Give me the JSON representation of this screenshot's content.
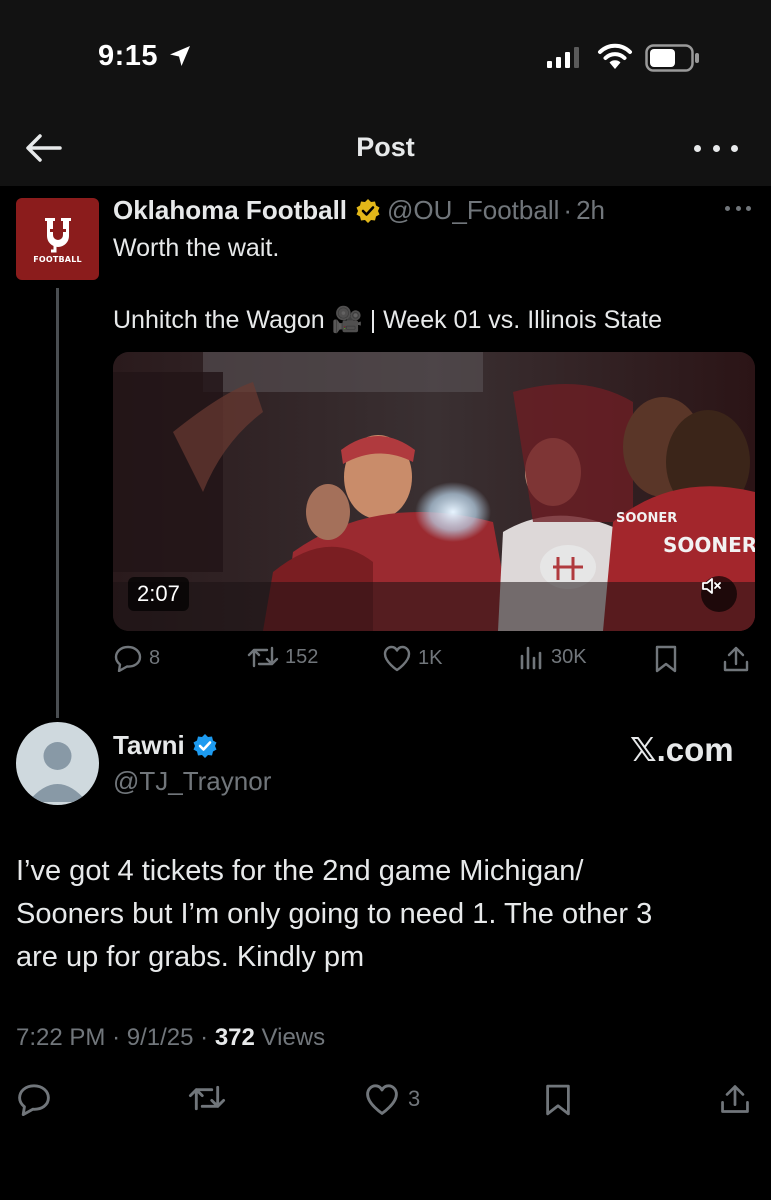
{
  "status_bar": {
    "time": "9:15"
  },
  "header": {
    "title": "Post"
  },
  "original_post": {
    "avatar_text": "FOOTBALL",
    "author": "Oklahoma Football",
    "handle": "@OU_Football",
    "separator": "·",
    "time": "2h",
    "text_line_1": "Worth the wait.",
    "text_line_2": "Unhitch the Wagon 🎥 | Week 01 vs. Illinois State",
    "video": {
      "duration": "2:07"
    },
    "stats": {
      "replies": "8",
      "reposts": "152",
      "likes": "1K",
      "views": "30K"
    },
    "colors": {
      "brand": "#8b1c1c",
      "verified": "#e2b719"
    }
  },
  "reply": {
    "author": "Tawni",
    "handle": "@TJ_Traynor",
    "watermark": "𝕏.com",
    "text_lines": [
      "I’ve got 4 tickets for the 2nd game Michigan/",
      "Sooners but I’m only going to need 1. The other 3",
      "are up for grabs. Kindly pm"
    ],
    "time": "7:22 PM",
    "separator": "·",
    "date": "9/1/25",
    "views_count": "372",
    "views_label": "Views",
    "likes": "3",
    "colors": {
      "verified": "#1d9bf0"
    }
  }
}
